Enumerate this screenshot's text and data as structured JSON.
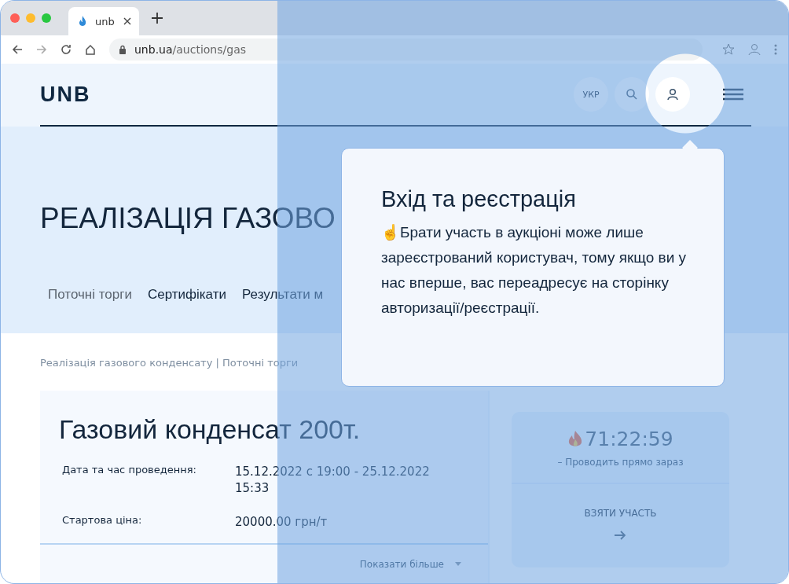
{
  "browser": {
    "tabs": [
      {
        "title": "unb",
        "selected": true
      }
    ],
    "url_host": "unb.ua",
    "url_path": "/auctions/gas"
  },
  "header": {
    "logo": "UNB",
    "language": "УКР"
  },
  "hero": {
    "title": "РЕАЛІЗАЦІЯ ГАЗОВО",
    "nav": [
      {
        "label": "Поточні торги",
        "selected": true
      },
      {
        "label": "Сертифікати",
        "selected": false
      },
      {
        "label": "Результати м",
        "selected": false
      }
    ]
  },
  "breadcrumb": "Реалізація газового конденсату | Поточні торги",
  "lot": {
    "title": "Газовий конденсат 200т.",
    "fields": [
      {
        "label": "Дата та час проведення:",
        "value": "15.12.2022 с 19:00 - 25.12.2022 15:33"
      },
      {
        "label": "Стартова ціна:",
        "value": "20000.00 грн/т"
      }
    ],
    "more": "Показати більше"
  },
  "status": {
    "timer": "71:22:59",
    "subtitle": "– Проводить прямо зараз",
    "action": "ВЗЯТИ УЧАСТЬ"
  },
  "popup": {
    "title": "Вхід та реєстрація",
    "text": "☝Брати участь в аукціоні може лише зареєстрований користувач, тому якщо ви у нас вперше, вас переадресує на сторінку авторизації/реєстрації."
  }
}
